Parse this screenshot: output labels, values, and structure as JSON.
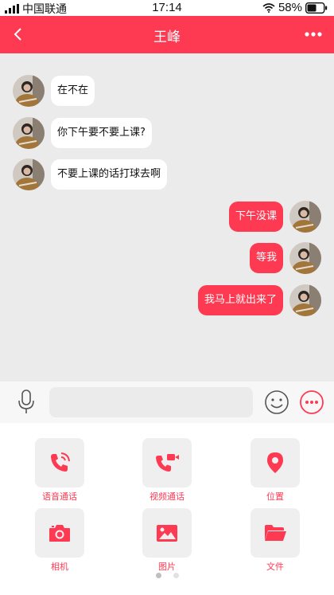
{
  "status_bar": {
    "carrier": "中国联通",
    "time": "17:14",
    "battery": "58%",
    "battery_level": 0.58
  },
  "header": {
    "title": "王峰"
  },
  "messages": [
    {
      "side": "in",
      "text": "在不在"
    },
    {
      "side": "in",
      "text": "你下午要不要上课?"
    },
    {
      "side": "in",
      "text": "不要上课的话打球去啊"
    },
    {
      "side": "out",
      "text": "下午没课"
    },
    {
      "side": "out",
      "text": "等我"
    },
    {
      "side": "out",
      "text": "我马上就出来了"
    }
  ],
  "input": {
    "value": "",
    "placeholder": ""
  },
  "tools": [
    {
      "label": "语音通话",
      "icon": "phone-ringing-icon"
    },
    {
      "label": "视频通话",
      "icon": "video-call-icon"
    },
    {
      "label": "位置",
      "icon": "location-pin-icon"
    },
    {
      "label": "相机",
      "icon": "camera-icon"
    },
    {
      "label": "图片",
      "icon": "image-icon"
    },
    {
      "label": "文件",
      "icon": "folder-icon"
    }
  ],
  "pager": {
    "pages": 2,
    "current": 1
  },
  "colors": {
    "accent": "#fe3a53",
    "background": "#ebebeb",
    "tile": "#efefef"
  }
}
